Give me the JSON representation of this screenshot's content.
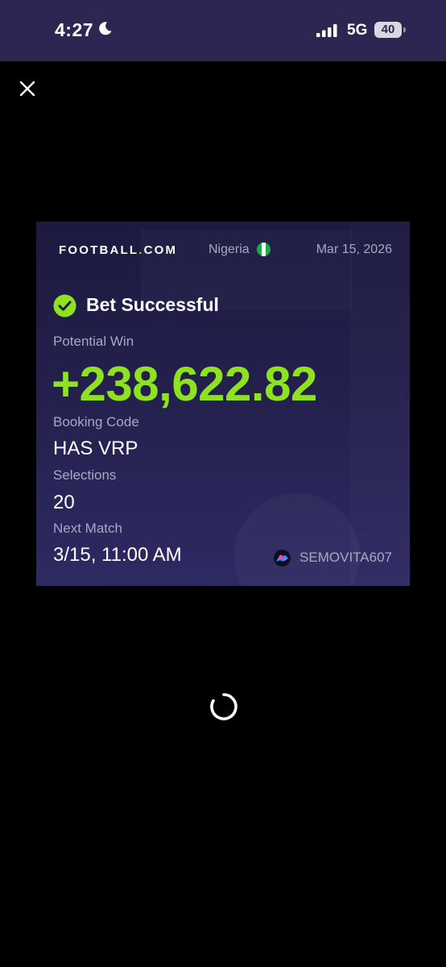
{
  "status_bar": {
    "time": "4:27",
    "network": "5G",
    "battery": "40"
  },
  "card": {
    "brand": {
      "prefix": "FOOTBALL",
      "dot": ".",
      "suffix": "COM"
    },
    "country": "Nigeria",
    "date": "Mar 15, 2026",
    "status": "Bet Successful",
    "potential_win_label": "Potential Win",
    "potential_win_value": "+238,622.82",
    "booking_code_label": "Booking Code",
    "booking_code_value": "HAS VRP",
    "selections_label": "Selections",
    "selections_value": "20",
    "next_match_label": "Next Match",
    "next_match_value": "3/15, 11:00 AM",
    "username": "SEMOVITA607"
  },
  "colors": {
    "header_bg": "#2b2752",
    "accent_green": "#8fe21f",
    "muted_text": "#a9a7c4"
  },
  "icons": [
    "moon-icon",
    "signal-icon",
    "battery-icon",
    "close-icon",
    "nigeria-flag-icon",
    "check-circle-icon",
    "avatar-icon",
    "loading-spinner"
  ]
}
